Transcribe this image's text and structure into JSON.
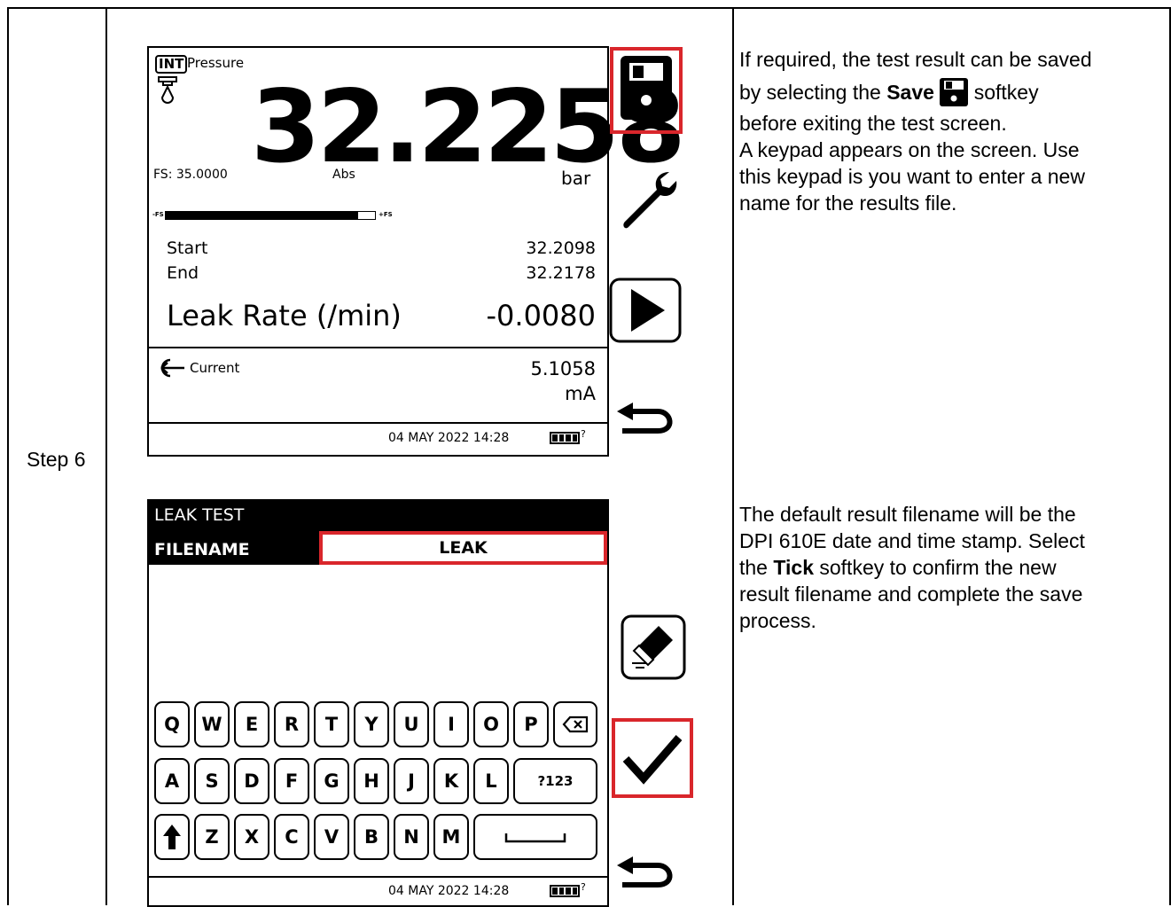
{
  "step": {
    "label": "Step 6"
  },
  "screen1": {
    "int_badge": "INT",
    "function_label": "Pressure",
    "reading": "32.2258",
    "fs_label": "FS: 35.0000",
    "abs_label": "Abs",
    "unit": "bar",
    "bar_minus": "-FS",
    "bar_plus": "+FS",
    "bar_fill_fraction": 0.92,
    "start_label": "Start",
    "start_value": "32.2098",
    "end_label": "End",
    "end_value": "32.2178",
    "leak_label": "Leak Rate (/min)",
    "leak_value": "-0.0080",
    "current_label": "Current",
    "current_value": "5.1058",
    "current_unit": "mA",
    "datetime": "04 MAY 2022 14:28"
  },
  "screen2": {
    "title": "LEAK TEST",
    "filename_label": "FILENAME",
    "filename_value": "LEAK",
    "rows": [
      [
        "Q",
        "W",
        "E",
        "R",
        "T",
        "Y",
        "U",
        "I",
        "O",
        "P"
      ],
      [
        "A",
        "S",
        "D",
        "F",
        "G",
        "H",
        "J",
        "K",
        "L"
      ],
      [
        "Z",
        "X",
        "C",
        "V",
        "B",
        "N",
        "M"
      ]
    ],
    "num_key": "?123",
    "datetime": "04 MAY 2022 14:28"
  },
  "text1": {
    "line1": "If required, the test result can be saved",
    "line2a": "by selecting the ",
    "line2b": "Save",
    "line2c": " softkey",
    "line3": "before exiting the test screen.",
    "line4": "A keypad appears on the screen. Use",
    "line5": "this keypad is you want to enter a new",
    "line6": "name for the results file."
  },
  "text2": {
    "line1": "The default result filename will be the",
    "line2": "DPI 610E date and time stamp. Select",
    "line3a": "the ",
    "line3b": "Tick",
    "line3c": " softkey to confirm the new",
    "line4": "result filename and complete the save",
    "line5": "process."
  },
  "colors": {
    "highlight": "#d9262b",
    "black": "#000000"
  }
}
